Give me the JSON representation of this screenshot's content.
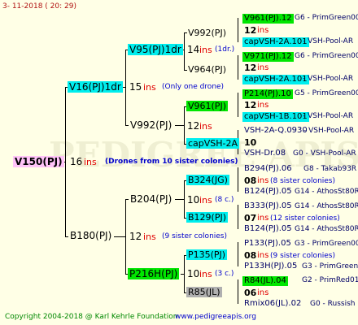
{
  "timestamp": "3-  11-2018  (  20:  29)",
  "copyright": "Copyright 2004-2018 @ Karl Kehrle Foundation",
  "website": "www.pedigreeapis.org",
  "watermark": "PEDIGREE APIS",
  "root": {
    "name": "V150(PJ)",
    "ins": "16",
    "ins_unit": "ins",
    "note": "(Drones from 10 sister colonies)"
  },
  "gen1": {
    "sire": {
      "name": "V16(PJ)1dr",
      "ins": "15",
      "ins_unit": "ins",
      "note": "(Only one drone)"
    },
    "dam": {
      "name": "B180(PJ)",
      "ins": "12",
      "ins_unit": "ins",
      "note": "(9 sister colonies)"
    }
  },
  "gen2": {
    "sire_sire": {
      "name": "V95(PJ)1dr",
      "ins": "14",
      "ins_unit": "ins",
      "note": "(1dr.)"
    },
    "sire_dam": {
      "name": "V992(PJ)",
      "ins": "12",
      "ins_unit": "ins"
    },
    "dam_sire": {
      "name": "B204(PJ)",
      "ins": "10",
      "ins_unit": "ins",
      "note": "(8 c.)"
    },
    "dam_dam": {
      "name": "P216H(PJ)",
      "ins": "10",
      "ins_unit": "ins",
      "note": "(3 c.)"
    }
  },
  "gen3": [
    {
      "name": "V992(PJ)"
    },
    {
      "name": "V964(PJ)"
    },
    {
      "name": "V961(PJ)"
    },
    {
      "name": "capVSH-2A"
    },
    {
      "name": "B324(JG)",
      "ins": "08",
      "ins_unit": "ins",
      "note": "(8 c.)"
    },
    {
      "name": "B129(PJ)",
      "ins": "07",
      "ins_unit": "ins",
      "note": "(12 sister colonies)"
    },
    {
      "name": "P135(PJ)"
    },
    {
      "name": "R85(JL)"
    }
  ],
  "gen4": [
    {
      "name": "V961(PJ).12",
      "info": "G6 - PrimGreen00"
    },
    {
      "name": "12",
      "unit": "ins"
    },
    {
      "name": "capVSH-2A.101",
      "info": "- VSH-Pool-AR"
    },
    {
      "name": "V971(PJ).12",
      "info": "G6 - PrimGreen00"
    },
    {
      "name": "12",
      "unit": "ins"
    },
    {
      "name": "capVSH-2A.101",
      "info": "- VSH-Pool-AR"
    },
    {
      "name": "P214(PJ).10",
      "info": "G5 - PrimGreen00"
    },
    {
      "name": "12",
      "unit": "ins"
    },
    {
      "name": "capVSH-1B.101",
      "info": "- VSH-Pool-AR"
    },
    {
      "name": "VSH-2A-Q.0930",
      "info": "- VSH-Pool-AR"
    },
    {
      "name": "10"
    },
    {
      "name": "VSH-Dr.08",
      "info": "G0 - VSH-Pool-AR"
    },
    {
      "name": "B294(PJ).06",
      "info": "G8 - Takab93R"
    },
    {
      "name": "08",
      "unit": "ins",
      "note": "(8 sister colonies)"
    },
    {
      "name": "B124(PJ).05",
      "info": "G14 - AthosSt80R"
    },
    {
      "name": "B333(PJ).05",
      "info": "G14 - AthosSt80R"
    },
    {
      "name": "07",
      "unit": "ins",
      "note": "(12 sister colonies)"
    },
    {
      "name": "B124(PJ).05",
      "info": "G14 - AthosSt80R"
    },
    {
      "name": "P133(PJ).05",
      "info": "G3 - PrimGreen00"
    },
    {
      "name": "08",
      "unit": "ins",
      "note": "(9 sister colonies)"
    },
    {
      "name": "P133H(PJ).05",
      "info": "G3 - PrimGreen00"
    },
    {
      "name": "R84(JL).04",
      "info": "G2 - PrimRed01"
    },
    {
      "name": "06",
      "unit": "ins"
    },
    {
      "name": "Rmix06(JL).02",
      "info": "G0 - Russish"
    }
  ],
  "colors": {
    "green": "#00E600",
    "cyan": "#00EEEE",
    "gray": "#B0B0B0",
    "pink": "#FFC4F8",
    "background": "#FFFFE6",
    "blue": "#0000CC",
    "red": "#E00000"
  }
}
